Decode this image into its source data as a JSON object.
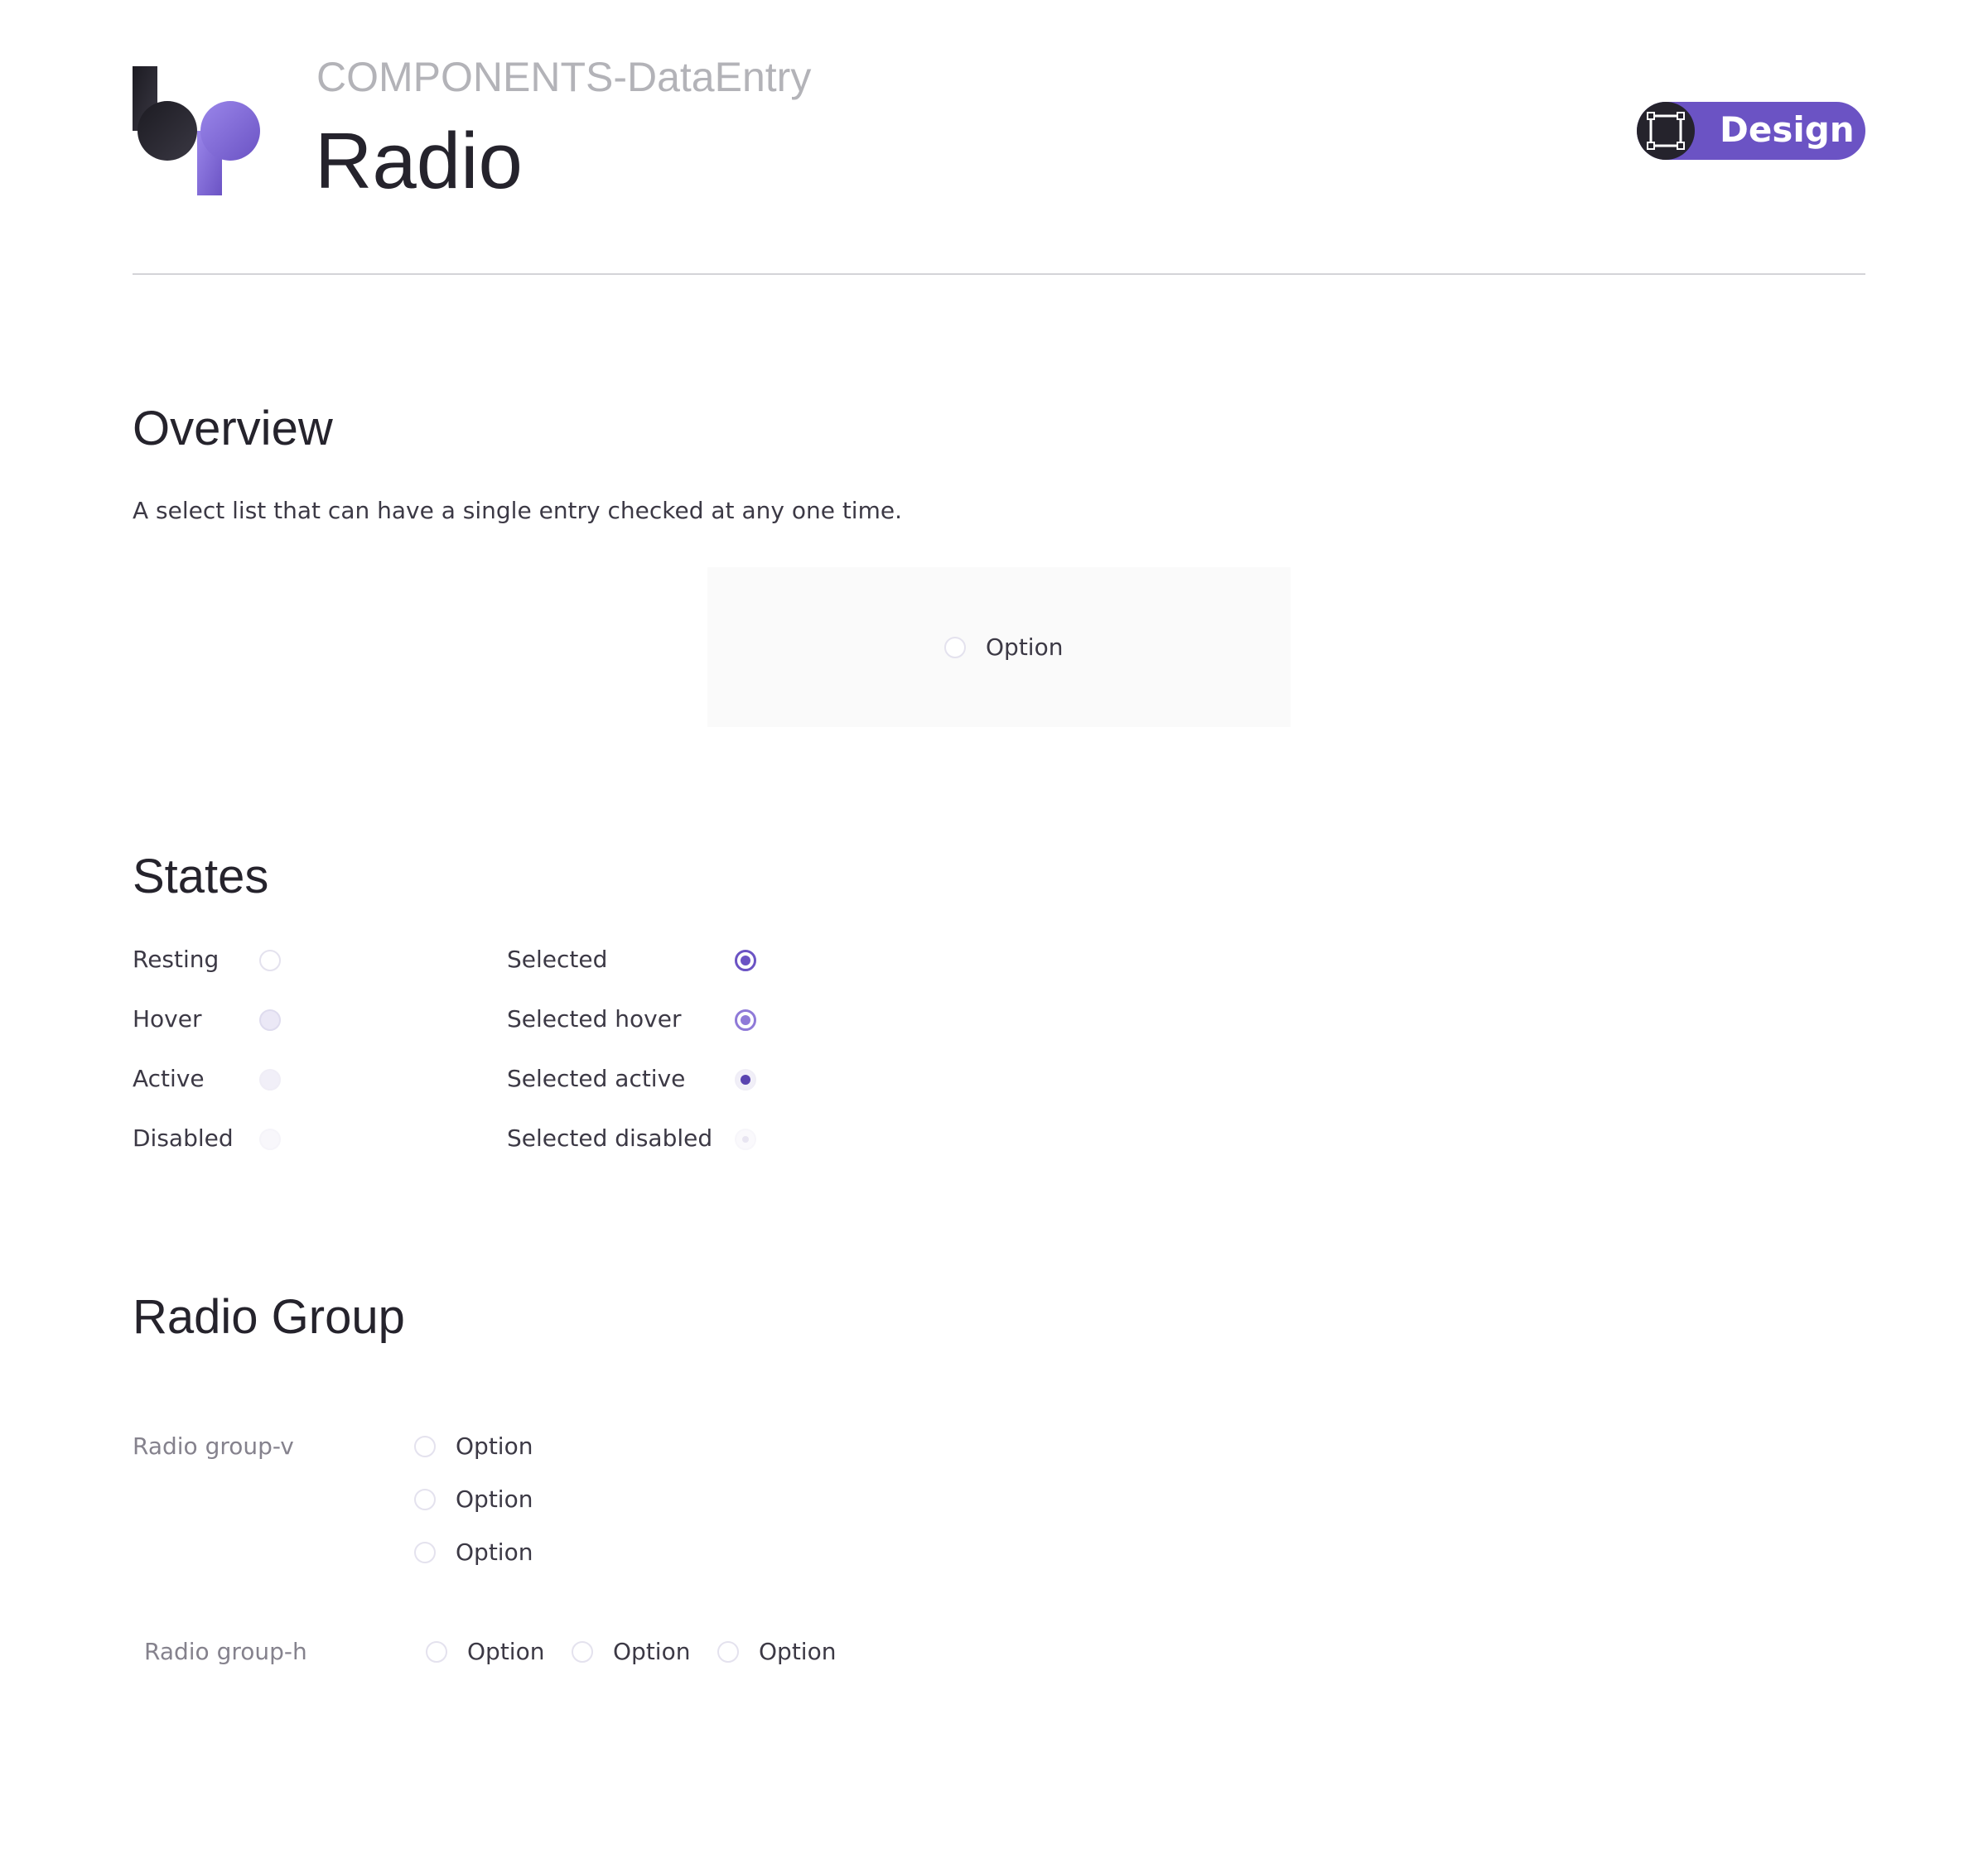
{
  "header": {
    "category": "COMPONENTS-DataEntry",
    "title": "Radio",
    "badge_label": "Design",
    "badge_icon": "frame-icon",
    "logo": "bp-logo"
  },
  "colors": {
    "accent": "#6b53c4",
    "accent_hover": "#8f7ad8",
    "accent_active": "#5a44b0",
    "title_text": "#25232c",
    "muted_text": "#b3b3b8"
  },
  "overview": {
    "title": "Overview",
    "description": "A select list that can have a single entry checked at any one time.",
    "preview_option": "Option"
  },
  "states": {
    "title": "States",
    "unselected": [
      "Resting",
      "Hover",
      "Active",
      "Disabled"
    ],
    "selected": [
      "Selected",
      "Selected hover",
      "Selected active",
      "Selected disabled"
    ]
  },
  "radio_group": {
    "title": "Radio Group",
    "vertical_label": "Radio group-v",
    "vertical_options": [
      "Option",
      "Option",
      "Option"
    ],
    "horizontal_label": "Radio group-h",
    "horizontal_options": [
      "Option",
      "Option",
      "Option"
    ]
  }
}
